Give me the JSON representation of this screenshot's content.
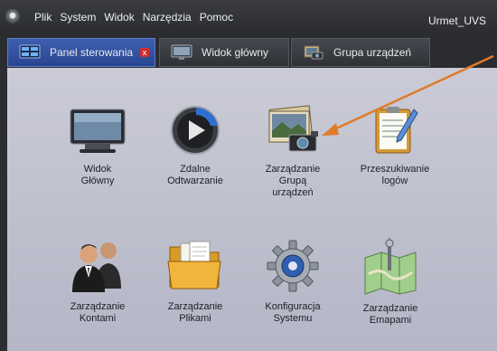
{
  "menubar": {
    "items": [
      "Plik",
      "System",
      "Widok",
      "Narzędzia",
      "Pomoc"
    ],
    "app_name": "Urmet_UVS"
  },
  "tabs": [
    {
      "label": "Panel sterowania",
      "icon": "dashboard-monitor-icon",
      "active": true,
      "close": "x"
    },
    {
      "label": "Widok główny",
      "icon": "monitor-icon",
      "active": false
    },
    {
      "label": "Grupa urządzeń",
      "icon": "camera-group-icon",
      "active": false
    }
  ],
  "tiles": [
    {
      "label": "Widok\nGłówny",
      "icon": "tv-monitor-icon"
    },
    {
      "label": "Zdalne\nOdtwarzanie",
      "icon": "playback-icon"
    },
    {
      "label": "Zarządzanie\nGrupą\nurządzeń",
      "icon": "photo-group-icon"
    },
    {
      "label": "Przeszukiwanie\nlogów",
      "icon": "clipboard-log-icon"
    },
    {
      "label": "Zarządzanie\nKontami",
      "icon": "users-icon"
    },
    {
      "label": "Zarządzanie\nPlikami",
      "icon": "folder-icon"
    },
    {
      "label": "Konfiguracja\nSystemu",
      "icon": "gear-config-icon"
    },
    {
      "label": "Zarządzanie\nEmapami",
      "icon": "map-pin-icon"
    }
  ],
  "colors": {
    "tab_active": "#2f4a9a",
    "panel": "#c4c5d2",
    "arrow": "#e07b2a"
  }
}
